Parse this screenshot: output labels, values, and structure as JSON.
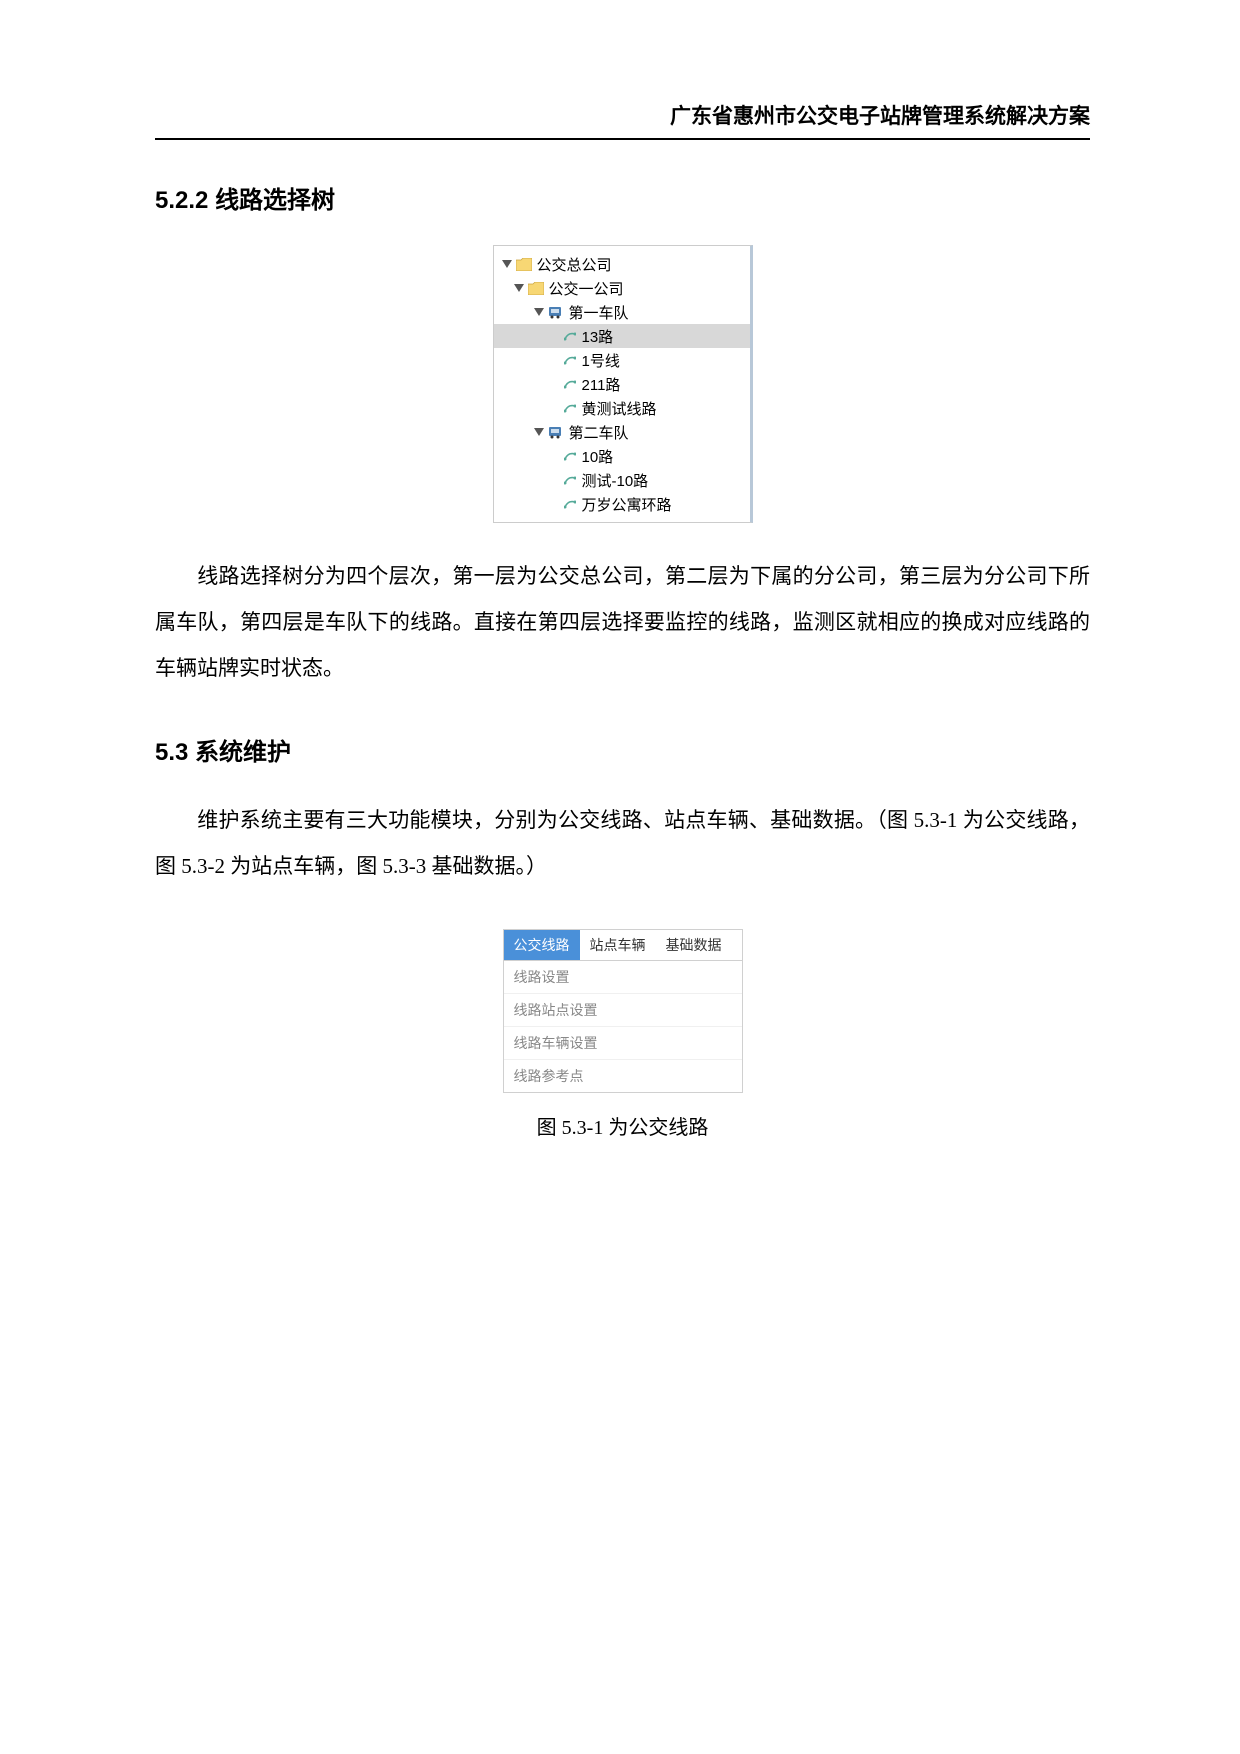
{
  "header": {
    "title": "广东省惠州市公交电子站牌管理系统解决方案"
  },
  "section1": {
    "number": "5.2.2",
    "title": "线路选择树"
  },
  "tree": {
    "root": "公交总公司",
    "child1": "公交一公司",
    "team1": "第一车队",
    "routes1": [
      "13路",
      "1号线",
      "211路",
      "黄测试线路"
    ],
    "team2": "第二车队",
    "routes2": [
      "10路",
      "测试-10路",
      "万岁公寓环路"
    ]
  },
  "paragraph1": "线路选择树分为四个层次，第一层为公交总公司，第二层为下属的分公司，第三层为分公司下所属车队，第四层是车队下的线路。直接在第四层选择要监控的线路，监测区就相应的换成对应线路的车辆站牌实时状态。",
  "section2": {
    "number": "5.3",
    "title": "系统维护"
  },
  "paragraph2": "维护系统主要有三大功能模块，分别为公交线路、站点车辆、基础数据。（图 5.3-1 为公交线路，图 5.3-2 为站点车辆，图 5.3-3 基础数据。）",
  "tabs": {
    "active": "公交线路",
    "t2": "站点车辆",
    "t3": "基础数据"
  },
  "menu": {
    "m1": "线路设置",
    "m2": "线路站点设置",
    "m3": "线路车辆设置",
    "m4": "线路参考点"
  },
  "caption": "图 5.3-1 为公交线路"
}
